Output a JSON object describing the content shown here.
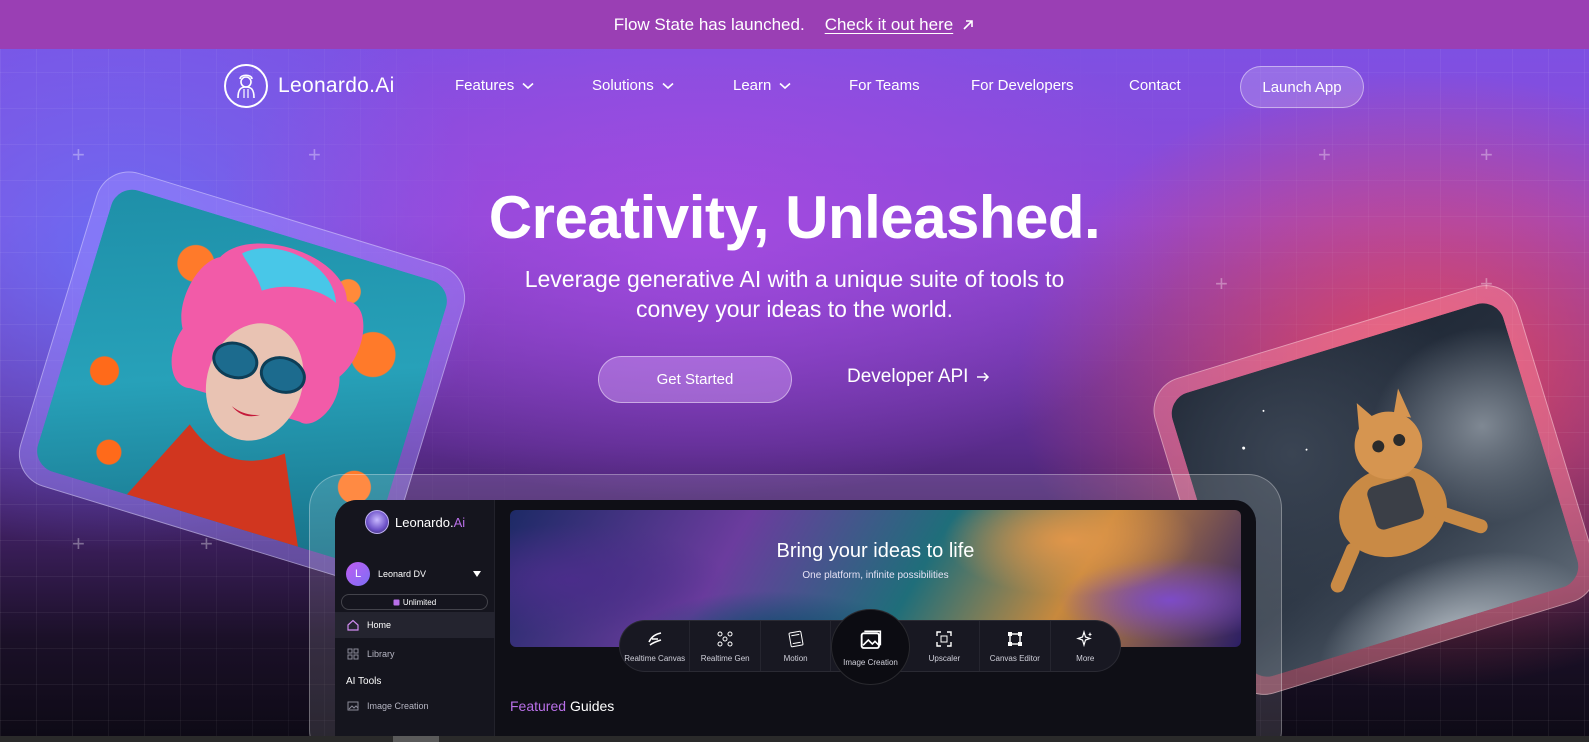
{
  "announcement": {
    "text": "Flow State has launched.",
    "link": "Check it out here"
  },
  "nav": {
    "brand": "Leonardo.Ai",
    "items": [
      "Features",
      "Solutions",
      "Learn",
      "For Teams",
      "For Developers",
      "Contact"
    ],
    "launch": "Launch App"
  },
  "hero": {
    "title": "Creativity, Unleashed.",
    "sub1": "Leverage generative AI with a unique suite of tools to",
    "sub2": "convey your ideas to the world.",
    "cta": "Get Started",
    "dev": "Developer API"
  },
  "app": {
    "brand_a": "Leonardo.",
    "brand_b": "Ai",
    "avatar": "L",
    "user": "Leonard DV",
    "badge": "Unlimited",
    "nav": {
      "home": "Home",
      "library": "Library"
    },
    "section": "AI Tools",
    "tool_item": "Image Creation",
    "banner_title": "Bring your ideas to life",
    "banner_sub": "One platform, infinite possibilities",
    "tools": [
      "Realtime Canvas",
      "Realtime Gen",
      "Motion",
      "Image Creation",
      "Upscaler",
      "Canvas Editor",
      "More"
    ],
    "featured_a": "Featured",
    "featured_b": "Guides"
  },
  "colors": {
    "announcement_bg": "#9a3fb4",
    "accent": "#b970e8"
  }
}
